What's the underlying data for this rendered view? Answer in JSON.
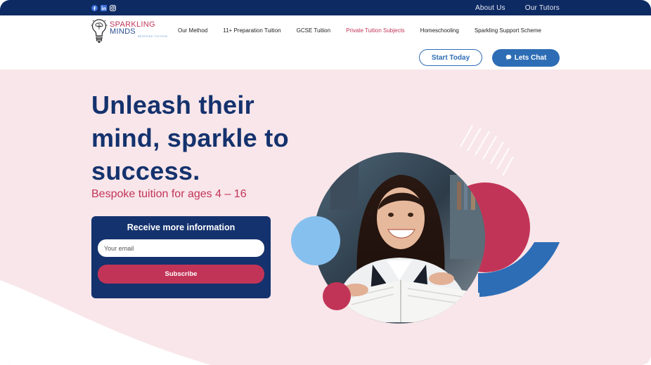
{
  "topbar": {
    "social_icons": [
      "facebook-icon",
      "linkedin-icon",
      "instagram-icon"
    ],
    "links": [
      "About Us",
      "Our Tutors"
    ]
  },
  "logo": {
    "line1": "SPARKLING",
    "line2": "MINDS",
    "tagline": "BESPOKE TUITION"
  },
  "nav": {
    "items": [
      {
        "label": "Our Method",
        "active": false
      },
      {
        "label": "11+ Preparation Tuition",
        "active": false
      },
      {
        "label": "GCSE Tuition",
        "active": false
      },
      {
        "label": "Private Tuition Subjects",
        "active": true
      },
      {
        "label": "Homeschooling",
        "active": false
      },
      {
        "label": "Sparkling Support Scheme",
        "active": false
      }
    ]
  },
  "cta": {
    "start_label": "Start Today",
    "chat_label": "Lets Chat"
  },
  "hero": {
    "title": "Unleash their mind, sparkle to success.",
    "subtitle": "Bespoke tuition for ages 4 – 16"
  },
  "form": {
    "title": "Receive more information",
    "email_placeholder": "Your email",
    "subscribe_label": "Subscribe"
  },
  "colors": {
    "navy": "#14326d",
    "topbar": "#0e2a63",
    "crimson": "#c23457",
    "blue": "#2d6db5",
    "light_blue": "#86c0ee",
    "hero_bg": "#f8e6ea"
  }
}
